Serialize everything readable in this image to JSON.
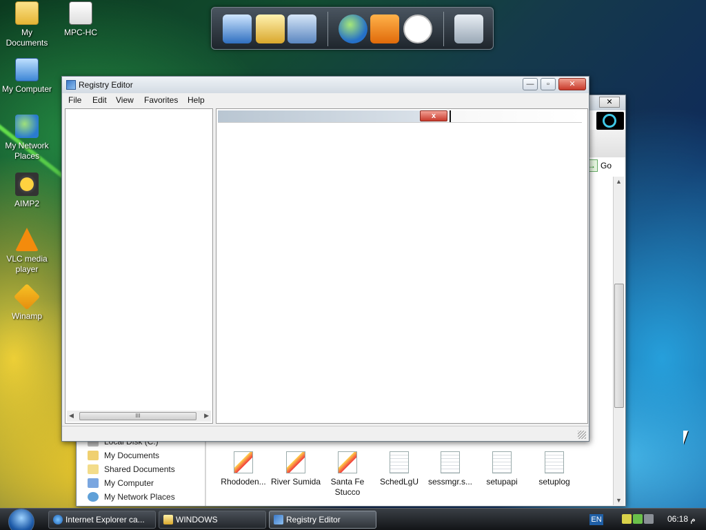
{
  "desktop": {
    "icons": [
      {
        "label": "My Documents"
      },
      {
        "label": "MPC-HC"
      },
      {
        "label": "My Computer"
      },
      {
        "label": "My Network Places"
      },
      {
        "label": "AIMP2"
      },
      {
        "label": "VLC media player"
      },
      {
        "label": "Winamp"
      }
    ]
  },
  "dock": {
    "items": [
      "my-computer-icon",
      "folder-icon",
      "control-panel-icon",
      "globe-icon",
      "media-player-icon",
      "clock-icon",
      "recycle-bin-icon"
    ]
  },
  "explorer": {
    "go_label": "Go",
    "close_glyph": "✕",
    "nav_items": [
      {
        "label": "Local Disk (C:)"
      },
      {
        "label": "My Documents"
      },
      {
        "label": "Shared Documents"
      },
      {
        "label": "My Computer"
      },
      {
        "label": "My Network Places"
      }
    ],
    "files": [
      {
        "label": "Rhododen..."
      },
      {
        "label": "River Sumida"
      },
      {
        "label": "Santa Fe Stucco"
      },
      {
        "label": "SchedLgU"
      },
      {
        "label": "sessmgr.s..."
      },
      {
        "label": "setupapi"
      },
      {
        "label": "setuplog"
      }
    ]
  },
  "regedit": {
    "title": "Registry Editor",
    "menu": [
      "File",
      "Edit",
      "View",
      "Favorites",
      "Help"
    ],
    "header_close_glyph": "x",
    "scroll_thumb_glyph": "III",
    "minimize_glyph": "—",
    "maximize_glyph": "▫",
    "close_glyph": "✕"
  },
  "taskbar": {
    "items": [
      {
        "label": "Internet Explorer ca..."
      },
      {
        "label": "WINDOWS"
      },
      {
        "label": "Registry Editor"
      }
    ],
    "language": "EN",
    "clock": "06:18 م"
  },
  "colors": {
    "accent": "#1d5aa8",
    "close_red": "#c8392a"
  }
}
